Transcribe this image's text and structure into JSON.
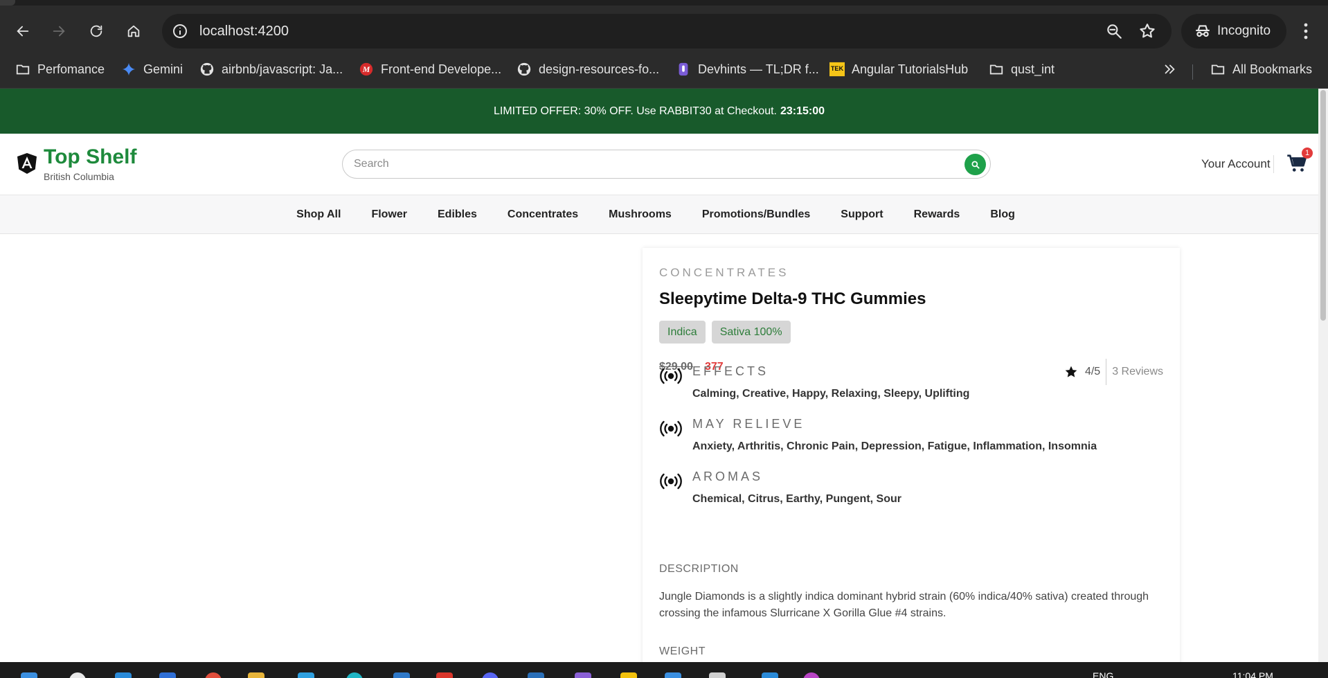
{
  "browser": {
    "url": "localhost:4200",
    "incognito_label": "Incognito",
    "bookmarks": [
      {
        "label": "Perfomance",
        "icon": "folder-icon"
      },
      {
        "label": "Gemini",
        "icon": "gemini-icon"
      },
      {
        "label": "airbnb/javascript: Ja...",
        "icon": "github-icon"
      },
      {
        "label": "Front-end Develope...",
        "icon": "m-logo-icon"
      },
      {
        "label": "design-resources-fo...",
        "icon": "github-icon"
      },
      {
        "label": "Devhints — TL;DR f...",
        "icon": "devhints-icon"
      },
      {
        "label": "Angular TutorialsHub",
        "icon": "tek-icon"
      },
      {
        "label": "qust_int",
        "icon": "folder-icon"
      }
    ],
    "all_bookmarks_label": "All Bookmarks"
  },
  "promo": {
    "text": "LIMITED OFFER: 30% OFF. Use RABBIT30 at Checkout.",
    "timer": "23:15:00"
  },
  "header": {
    "brand": "Top Shelf",
    "region": "British Columbia",
    "search_placeholder": "Search",
    "account_label": "Your Account",
    "cart_count": "1"
  },
  "nav": {
    "items": [
      "Shop All",
      "Flower",
      "Edibles",
      "Concentrates",
      "Mushrooms",
      "Promotions/Bundles",
      "Support",
      "Rewards",
      "Blog"
    ]
  },
  "product": {
    "category": "CONCENTRATES",
    "title": "Sleepytime Delta-9 THC Gummies",
    "tags": [
      "Indica",
      "Sativa 100%"
    ],
    "old_price": "$29.00",
    "new_price": "377",
    "rating": "4/5",
    "reviews": "3 Reviews",
    "attributes": [
      {
        "heading": "EFFECTS",
        "values": "Calming, Creative, Happy, Relaxing, Sleepy, Uplifting"
      },
      {
        "heading": "MAY RELIEVE",
        "values": "Anxiety, Arthritis, Chronic Pain, Depression, Fatigue, Inflammation, Insomnia"
      },
      {
        "heading": "AROMAS",
        "values": "Chemical, Citrus, Earthy, Pungent, Sour"
      }
    ],
    "description_heading": "DESCRIPTION",
    "description": "Jungle Diamonds is a slightly indica dominant hybrid strain (60% indica/40% sativa) created through crossing the infamous Slurricane X Gorilla Glue #4 strains.",
    "weight_heading": "WEIGHT"
  },
  "taskbar": {
    "lang": "ENG",
    "time": "11:04 PM"
  },
  "colors": {
    "promo_bg": "#185a2b",
    "brand_green": "#1e8a3c",
    "accent_green": "#1ea14a",
    "sale_red": "#e23b3b"
  }
}
